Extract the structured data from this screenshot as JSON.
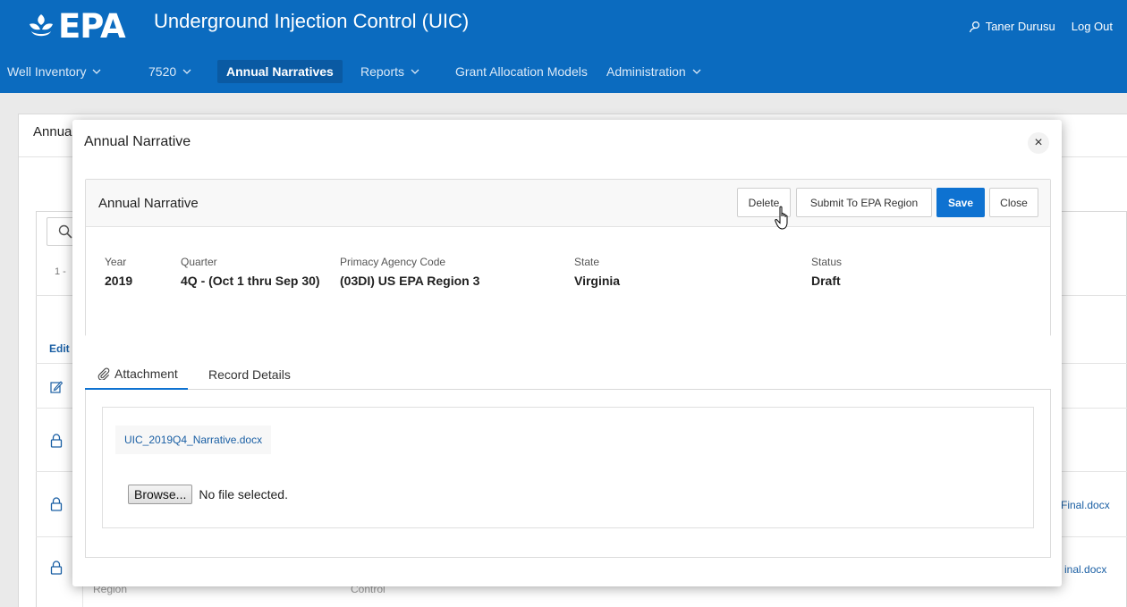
{
  "header": {
    "logo_text": "EPA",
    "app_title": "Underground Injection Control (UIC)",
    "user_name": "Taner Durusu",
    "logout_label": "Log Out",
    "brand_color": "#0b6bbf"
  },
  "nav": {
    "items": [
      {
        "label": "Well Inventory",
        "dropdown": true
      },
      {
        "label": "7520",
        "dropdown": true
      },
      {
        "label": "Annual Narratives",
        "dropdown": false,
        "active": true
      },
      {
        "label": "Reports",
        "dropdown": true
      },
      {
        "label": "Grant Allocation Models",
        "dropdown": false
      },
      {
        "label": "Administration",
        "dropdown": true
      }
    ]
  },
  "background": {
    "page_title": "Annua",
    "pagination": "1 -",
    "edit_header": "Edit",
    "row_link_1": "Final.docx",
    "row_link_2": "inal.docx",
    "faint_text_1": "Region",
    "faint_text_2": "Control"
  },
  "dialog": {
    "title": "Annual Narrative",
    "close_symbol": "×",
    "region": {
      "title": "Annual Narrative",
      "buttons": {
        "delete": "Delete",
        "submit": "Submit To EPA Region",
        "save": "Save",
        "close": "Close"
      },
      "fields": {
        "year": {
          "label": "Year",
          "value": "2019"
        },
        "quarter": {
          "label": "Quarter",
          "value": "4Q - (Oct 1 thru Sep 30)"
        },
        "agency": {
          "label": "Primacy Agency Code",
          "value": "(03DI) US EPA Region 3"
        },
        "state": {
          "label": "State",
          "value": "Virginia"
        },
        "status": {
          "label": "Status",
          "value": "Draft"
        }
      }
    },
    "tabs": [
      {
        "label": "Attachment",
        "icon": "paperclip-icon",
        "active": true
      },
      {
        "label": "Record Details",
        "active": false
      }
    ],
    "attachment": {
      "file_name": "UIC_2019Q4_Narrative.docx",
      "browse_label": "Browse...",
      "no_file_text": "No file selected."
    }
  }
}
